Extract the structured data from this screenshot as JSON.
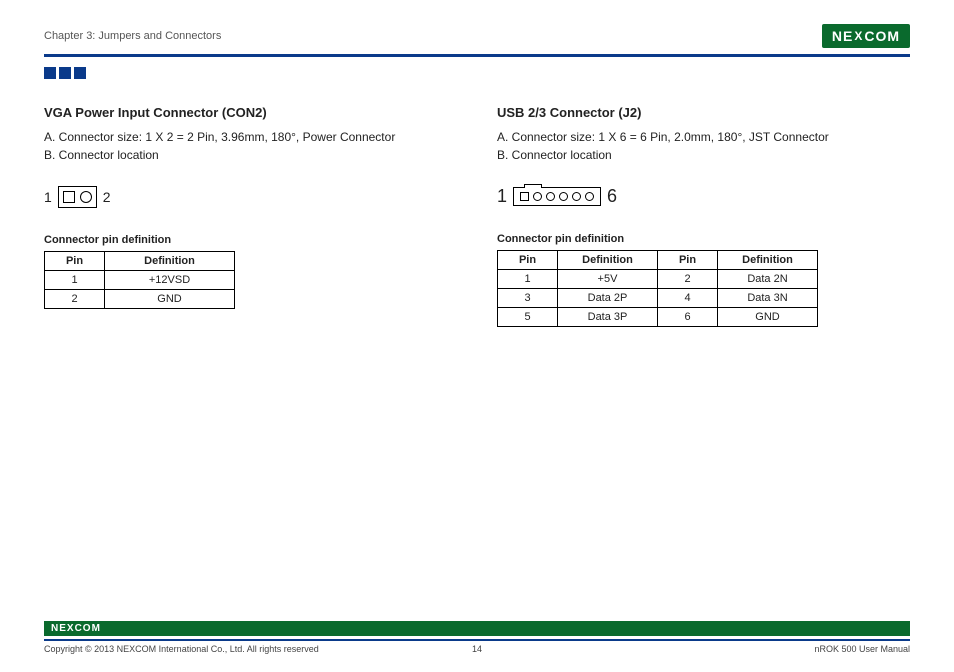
{
  "header": {
    "chapter": "Chapter 3: Jumpers and Connectors",
    "brand": "NE",
    "brand_x": "X",
    "brand2": "COM"
  },
  "left": {
    "title": "VGA Power Input Connector (CON2)",
    "lineA": "A. Connector size: 1 X 2 = 2 Pin, 3.96mm, 180°, Power Connector",
    "lineB": "B. Connector location",
    "lbl1": "1",
    "lbl2": "2",
    "tbl_title": "Connector pin definition",
    "th1": "Pin",
    "th2": "Definition",
    "rows": [
      {
        "pin": "1",
        "def": "+12VSD"
      },
      {
        "pin": "2",
        "def": "GND"
      }
    ]
  },
  "right": {
    "title": "USB 2/3 Connector (J2)",
    "lineA": "A. Connector size: 1 X 6 = 6 Pin, 2.0mm, 180°, JST Connector",
    "lineB": "B. Connector location",
    "lbl1": "1",
    "lbl2": "6",
    "tbl_title": "Connector pin definition",
    "th1": "Pin",
    "th2": "Definition",
    "th3": "Pin",
    "th4": "Definition",
    "rows": [
      {
        "p1": "1",
        "d1": "+5V",
        "p2": "2",
        "d2": "Data 2N"
      },
      {
        "p1": "3",
        "d1": "Data 2P",
        "p2": "4",
        "d2": "Data 3N"
      },
      {
        "p1": "5",
        "d1": "Data 3P",
        "p2": "6",
        "d2": "GND"
      }
    ]
  },
  "footer": {
    "copyright": "Copyright © 2013 NEXCOM International Co., Ltd. All rights reserved",
    "page": "14",
    "manual": "nROK 500 User Manual"
  }
}
